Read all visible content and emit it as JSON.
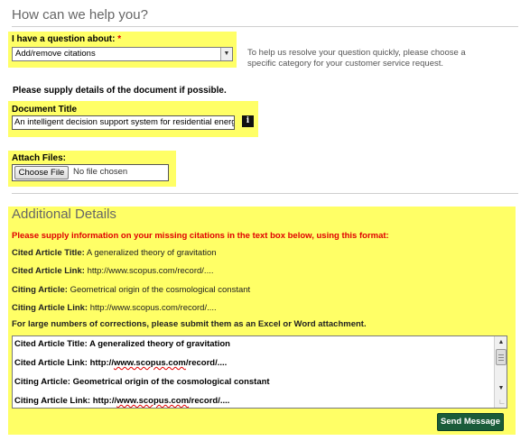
{
  "header": {
    "title": "How can we help you?"
  },
  "question": {
    "label": "I have a question about:",
    "required_marker": "*",
    "selected": "Add/remove citations",
    "hint": "To help us resolve your question quickly, please choose a specific category for your customer service request."
  },
  "document": {
    "supply_details": "Please supply details of the document if possible.",
    "title_label": "Document Title",
    "title_value": "An intelligent decision support system for residential energ",
    "info_glyph": "i"
  },
  "attach": {
    "label": "Attach Files:",
    "button_label": "Choose File",
    "status": "No file chosen"
  },
  "additional": {
    "title": "Additional Details",
    "instruction": "Please supply information on your missing citations in the text box below, using this format:",
    "format_lines": [
      {
        "label": "Cited Article Title:",
        "value": "A generalized theory of gravitation"
      },
      {
        "label": "Cited Article Link:",
        "value": "http://www.scopus.com/record/...."
      },
      {
        "label": "Citing Article:",
        "value": "Geometrical origin of the cosmological constant"
      },
      {
        "label": "Citing Article Link:",
        "value": "http://www.scopus.com/record/...."
      }
    ],
    "large_note": "For large numbers of corrections, please submit them as an Excel or Word attachment.",
    "textarea_lines": [
      {
        "label": "Cited Article Title:",
        "pre": "",
        "spell": "",
        "post": "A generalized theory of gravitation"
      },
      {
        "label": "Cited Article Link:",
        "pre": "http://",
        "spell": "www.scopus.com",
        "post": "/record/...."
      },
      {
        "label": "Citing Article:",
        "pre": "",
        "spell": "",
        "post": "Geometrical origin of the cosmological constant"
      },
      {
        "label": "Citing Article Link:",
        "pre": "http://",
        "spell": "www.scopus.com",
        "post": "/record/...."
      }
    ]
  },
  "actions": {
    "send_label": "Send Message"
  },
  "colors": {
    "highlight": "#ffff66",
    "required": "#e00000",
    "send_button": "#1a5c3a"
  }
}
